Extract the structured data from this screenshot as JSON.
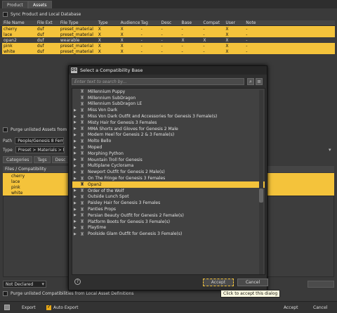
{
  "tabs": [
    "Product",
    "Assets"
  ],
  "sync_label": "Sync Product and Local Database",
  "asset_table": {
    "columns": [
      "File Name",
      "File Ext",
      "File Type",
      "Type",
      "Audience",
      "Tag",
      "Desc",
      "Base",
      "Compat",
      "User",
      "Note"
    ],
    "rows": [
      {
        "cells": [
          "cherry",
          "duf",
          "preset_material",
          "X",
          "X",
          "-",
          "-",
          "-",
          "-",
          "X",
          "-"
        ],
        "selected": true
      },
      {
        "cells": [
          "lace",
          "duf",
          "preset_material",
          "X",
          "X",
          "-",
          "-",
          "-",
          "-",
          "X",
          "-"
        ],
        "selected": true
      },
      {
        "cells": [
          "opan2",
          "duf",
          "wearable",
          "X",
          "X",
          "-",
          "-",
          "X",
          "X",
          "X",
          "-"
        ],
        "selected": false
      },
      {
        "cells": [
          "pink",
          "duf",
          "preset_material",
          "X",
          "X",
          "-",
          "-",
          "-",
          "-",
          "X",
          "-"
        ],
        "selected": true
      },
      {
        "cells": [
          "white",
          "duf",
          "preset_material",
          "X",
          "X",
          "-",
          "-",
          "-",
          "-",
          "X",
          "-"
        ],
        "selected": true
      }
    ]
  },
  "purge_unlisted_label": "Purge unlisted Assets from the",
  "path_label": "Path",
  "path_value": "People/Genesis 8 Female/C",
  "type_label": "Type",
  "type_value": "Preset > Materials > MDL",
  "sub_tabs": [
    "Categories",
    "Tags",
    "Desc"
  ],
  "compat_header": "Files / Compatibility",
  "compat_files": [
    "cherry",
    "lace",
    "pink",
    "white"
  ],
  "not_declared": "Not Declared",
  "purge_compat_label": "Purge unlisted Compatibilities from Local Asset Definitions",
  "bottom": {
    "export": "Export",
    "auto_export": "Auto Export",
    "accept": "Accept",
    "cancel": "Cancel"
  },
  "dialog": {
    "title": "Select a Compatibility Base",
    "search_placeholder": "Enter text to search by...",
    "items": [
      {
        "label": "Millennium Puppy",
        "arrow": false,
        "selected": false
      },
      {
        "label": "Millennium SubDragon",
        "arrow": false,
        "selected": false
      },
      {
        "label": "Millennium SubDragon LE",
        "arrow": false,
        "selected": false
      },
      {
        "label": "Miss Von Dark",
        "arrow": true,
        "selected": false
      },
      {
        "label": "Miss Von Dark Outfit and Accessories for Genesis 3 Female(s)",
        "arrow": true,
        "selected": false
      },
      {
        "label": "Misty Hair for Genesis 3 Females",
        "arrow": true,
        "selected": false
      },
      {
        "label": "MMA Shorts and Gloves for Genesis 2 Male",
        "arrow": true,
        "selected": false
      },
      {
        "label": "Modern Heel for Genesis 2 & 3 Female(s)",
        "arrow": true,
        "selected": false
      },
      {
        "label": "Molto Bello",
        "arrow": true,
        "selected": false
      },
      {
        "label": "Moped",
        "arrow": true,
        "selected": false
      },
      {
        "label": "Morphing Python",
        "arrow": true,
        "selected": false
      },
      {
        "label": "Mountain Troll for Genesis",
        "arrow": true,
        "selected": false
      },
      {
        "label": "Multiplane Cyclorama",
        "arrow": true,
        "selected": false
      },
      {
        "label": "Newport Outfit for Genesis 2 Male(s)",
        "arrow": true,
        "selected": false
      },
      {
        "label": "On The Fringe for Genesis 3 Females",
        "arrow": true,
        "selected": false
      },
      {
        "label": "Opan2",
        "arrow": false,
        "selected": true
      },
      {
        "label": "Order of the Wolf",
        "arrow": true,
        "selected": false
      },
      {
        "label": "Outside Lunch Spot",
        "arrow": true,
        "selected": false
      },
      {
        "label": "Paisley Hair for Genesis 3 Females",
        "arrow": true,
        "selected": false
      },
      {
        "label": "Panties Props",
        "arrow": true,
        "selected": false
      },
      {
        "label": "Persian Beauty Outfit for Genesis 2 Female(s)",
        "arrow": true,
        "selected": false
      },
      {
        "label": "Platform Boots for Genesis 3 Female(s)",
        "arrow": true,
        "selected": false
      },
      {
        "label": "Playtime",
        "arrow": true,
        "selected": false
      },
      {
        "label": "Poolside Glam Outfit for Genesis 3 Female(s)",
        "arrow": true,
        "selected": false
      }
    ],
    "accept": "Accept",
    "cancel": "Cancel",
    "help": "?"
  },
  "tooltip": "Click to accept this dialog",
  "colors": {
    "selection": "#f4c33b",
    "background": "#3a3a3a"
  }
}
